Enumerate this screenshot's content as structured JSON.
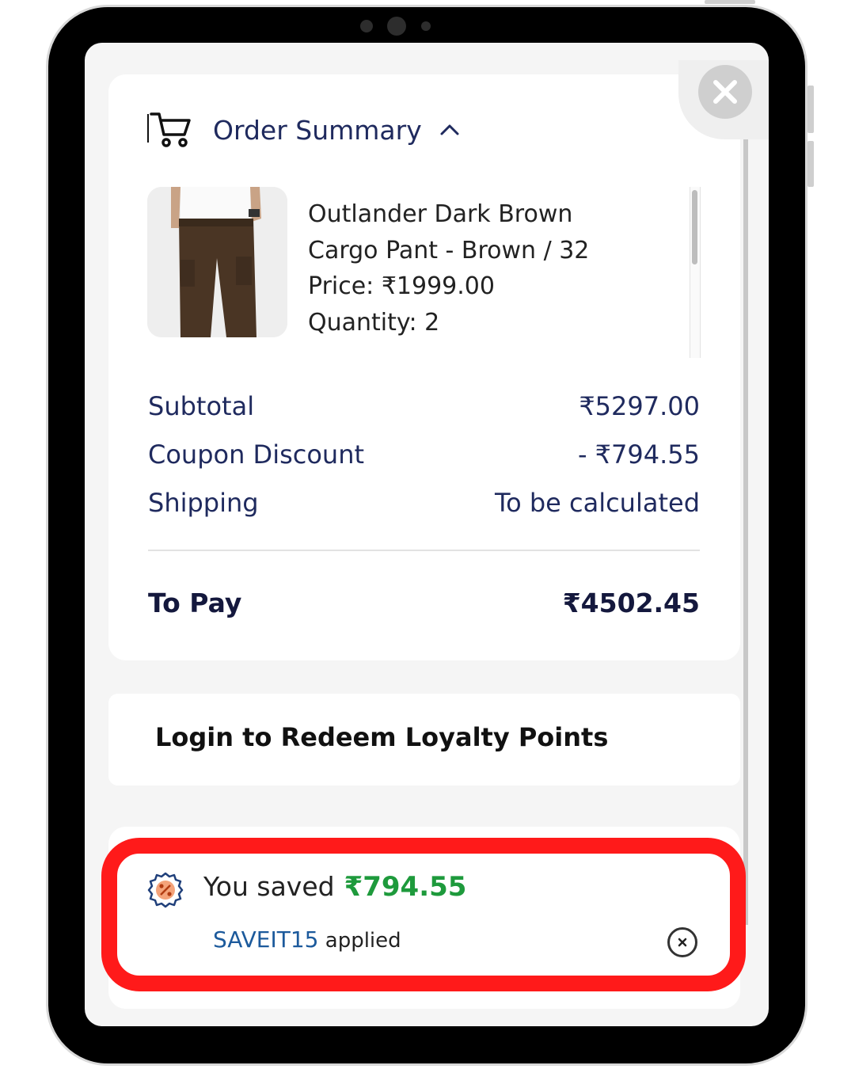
{
  "order_summary": {
    "title": "Order Summary"
  },
  "product": {
    "name_line1": "Outlander Dark Brown",
    "name_line2": "Cargo Pant - Brown / 32",
    "price": "Price: ₹1999.00",
    "quantity": "Quantity: 2"
  },
  "totals": {
    "subtotal_label": "Subtotal",
    "subtotal_value": "₹5297.00",
    "discount_label": "Coupon Discount",
    "discount_value": "- ₹794.55",
    "shipping_label": "Shipping",
    "shipping_value": "To be calculated",
    "pay_label": "To Pay",
    "pay_value": "₹4502.45"
  },
  "loyalty": {
    "label": "Login to Redeem Loyalty Points"
  },
  "savings": {
    "prefix": "You saved",
    "amount": "₹794.55",
    "coupon_code": "SAVEIT15",
    "coupon_suffix": "applied"
  },
  "icons": {
    "close": "close-icon",
    "cart": "cart-icon",
    "chevron": "chevron-up-icon",
    "discount": "discount-badge-icon",
    "remove": "remove-coupon-icon"
  },
  "colors": {
    "primary_text": "#1f2a5e",
    "savings_green": "#1e9a3c",
    "coupon_blue": "#1c5a9c",
    "highlight_red": "#ff1a1a"
  }
}
